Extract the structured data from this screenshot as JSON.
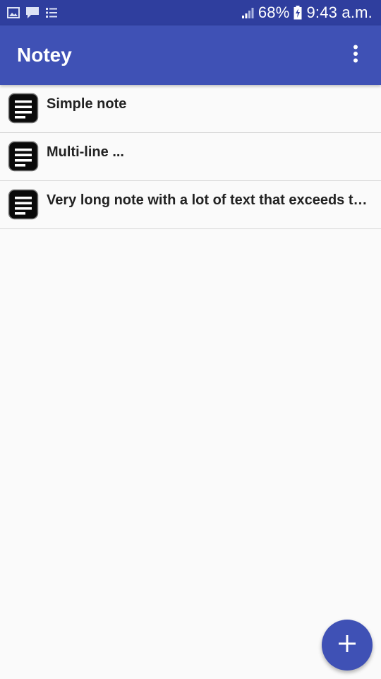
{
  "status_bar": {
    "battery": "68%",
    "time": "9:43 a.m.",
    "icons": [
      "image-icon",
      "chat-icon",
      "list-icon",
      "signal-icon",
      "battery-charging-icon"
    ]
  },
  "app_bar": {
    "title": "Notey",
    "overflow_icon": "more-vert-icon"
  },
  "notes": [
    {
      "title": "Simple note",
      "icon": "note-icon"
    },
    {
      "title": "Multi-line ...",
      "icon": "note-icon"
    },
    {
      "title": "Very long note with a lot of text that exceeds th…",
      "icon": "note-icon"
    }
  ],
  "fab": {
    "icon": "add-icon"
  },
  "colors": {
    "status_bar": "#2f3e9e",
    "app_bar": "#3f51b5",
    "background": "#fafafa",
    "fab": "#3f51b5"
  }
}
